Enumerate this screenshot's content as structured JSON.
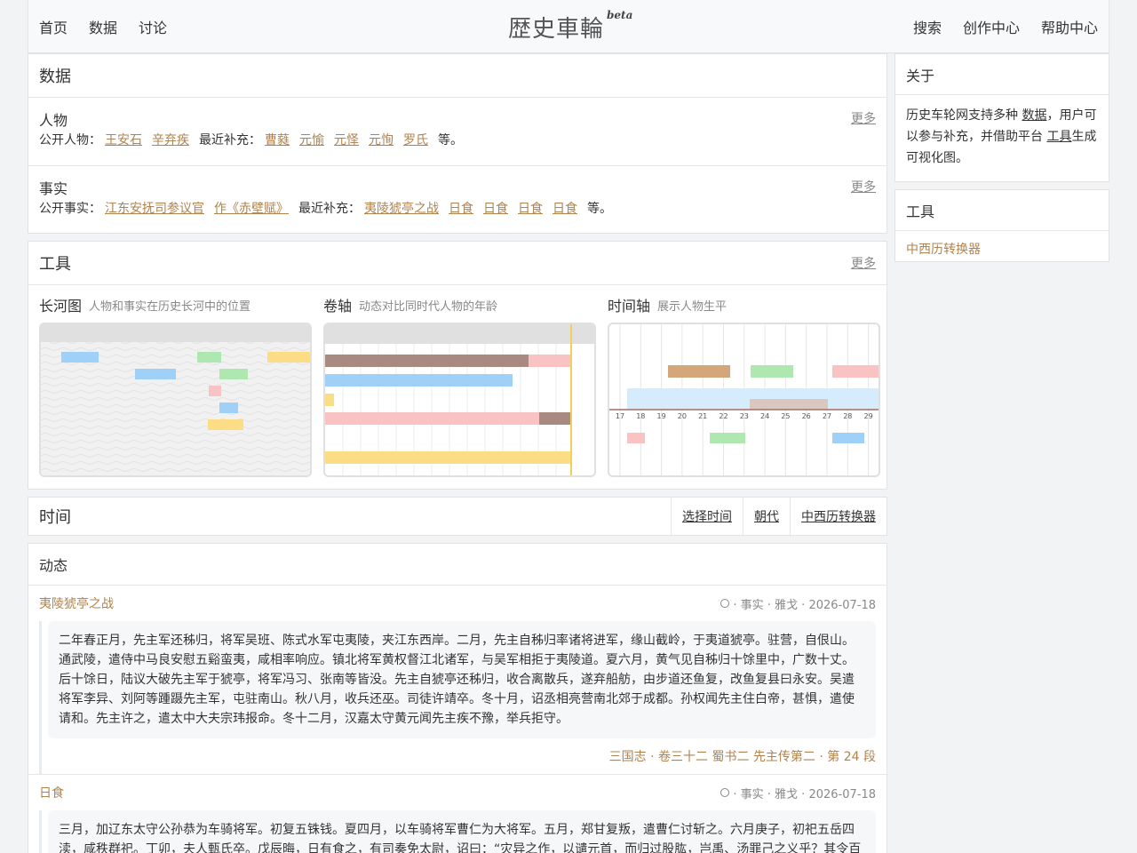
{
  "nav": {
    "left": [
      "首页",
      "数据",
      "讨论"
    ],
    "brand": "歴史車輪",
    "brand_sup": "beta",
    "right": [
      "搜索",
      "创作中心",
      "帮助中心"
    ]
  },
  "data_card": {
    "title": "数据",
    "more": "更多",
    "people": {
      "title": "人物",
      "public_label": "公开人物：",
      "public": [
        "王安石",
        "辛弃疾"
      ],
      "recent_label": "最近补充：",
      "recent": [
        "曹蕤",
        "元愉",
        "元怿",
        "元恂",
        "罗氏"
      ],
      "etc": "等。"
    },
    "facts": {
      "title": "事实",
      "public_label": "公开事实：",
      "public": [
        "江东安抚司参议官",
        "作《赤壁赋》"
      ],
      "recent_label": "最近补充：",
      "recent": [
        "夷陵猇亭之战",
        "日食",
        "日食",
        "日食",
        "日食"
      ],
      "etc": "等。"
    }
  },
  "tools_card": {
    "title": "工具",
    "more": "更多",
    "tools": [
      {
        "name": "长河图",
        "desc": "人物和事实在历史长河中的位置"
      },
      {
        "name": "卷轴",
        "desc": "动态对比同时代人物的年龄"
      },
      {
        "name": "时间轴",
        "desc": "展示人物生平"
      }
    ],
    "timeline_ticks": [
      "17",
      "18",
      "19",
      "20",
      "21",
      "22",
      "23",
      "24",
      "25",
      "26",
      "27",
      "28",
      "29"
    ]
  },
  "time_card": {
    "title": "时间",
    "tabs": [
      "选择时间",
      "朝代",
      "中西历转换器"
    ]
  },
  "feed": {
    "title": "动态",
    "items": [
      {
        "title": "夷陵猇亭之战",
        "meta": "· 事实 · 雅戈 · 2026-07-18",
        "text": "二年春正月，先主军还秭归，将军吴班、陈式水军屯夷陵，夹江东西岸。二月，先主自秭归率诸将进军，缘山截岭，于夷道猇亭。驻营，自佷山。通武陵，遣侍中马良安慰五谿蛮夷，咸相率响应。镇北将军黄权督江北诸军，与吴军相拒于夷陵道。夏六月，黄气见自秭归十馀里中，广数十丈。后十馀日，陆议大破先主军于猇亭，将军冯习、张南等皆没。先主自猇亭还秭归，收合离散兵，遂弃船舫，由步道还鱼复，改鱼复县曰永安。吴遣将军李异、刘阿等踵蹑先主军，屯驻南山。秋八月，收兵还巫。司徒许靖卒。冬十月，诏丞相亮营南北郊于成都。孙权闻先主住白帝，甚惧，遣使请和。先主许之，遣太中大夫宗玮报命。冬十二月，汉嘉太守黄元闻先主疾不豫，举兵拒守。",
        "cite": "三国志 · 卷三十二 蜀书二 先主传第二 · 第 24 段"
      },
      {
        "title": "日食",
        "meta": "· 事实 · 雅戈 · 2026-07-18",
        "text": "三月，加辽东太守公孙恭为车骑将军。初复五铢钱。夏四月，以车骑将军曹仁为大将军。五月，郑甘复叛，遣曹仁讨斩之。六月庚子，初祀五岳四渎，咸秩群祀。丁卯，夫人甄氏卒。戊辰晦，日有食之，有司奏免太尉，诏曰：“灾异之作，以谴元首，而归过股肱，岂禹、汤罪己之义乎？其令百"
      }
    ]
  },
  "sidebar": {
    "about_title": "关于",
    "about_text1": "历史车轮网支持多种",
    "about_link1": "数据",
    "about_text2": "，用户可以参与补充，并借助平台",
    "about_link2": "工具",
    "about_text3": "生成可视化图。",
    "tools_title": "工具",
    "tools_link": "中西历转换器"
  },
  "colors": {
    "accent": "#b0834e",
    "blue": "#9fd0f7",
    "green": "#aee8b0",
    "pink": "#f9c3c3",
    "yellow": "#fcdc84",
    "brown": "#a98a80",
    "tan": "#d4a77a"
  }
}
